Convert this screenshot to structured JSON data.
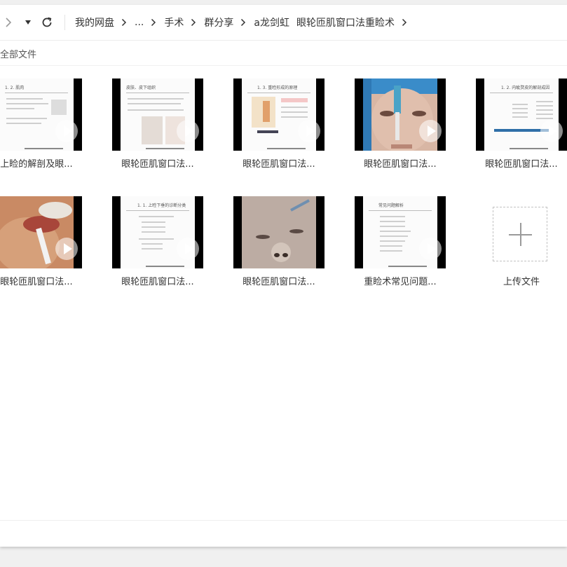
{
  "toolbar": {
    "breadcrumb": [
      "我的网盘",
      "...",
      "手术",
      "群分享",
      "a龙剑虹",
      "眼轮匝肌窗口法重睑术"
    ]
  },
  "subbar": {
    "all_files_label": "全部文件"
  },
  "files": [
    {
      "name": "上睑的解剖及眼...",
      "slide_title": "1. 2.  肌肉",
      "kind": "slide"
    },
    {
      "name": "眼轮匝肌窗口法...",
      "slide_title": "皮肤、皮下组织",
      "kind": "slide"
    },
    {
      "name": "眼轮匝肌窗口法...",
      "slide_title": "1. 3.  重睑形成的原理",
      "kind": "slide"
    },
    {
      "name": "眼轮匝肌窗口法...",
      "slide_title": "",
      "kind": "photo-face"
    },
    {
      "name": "眼轮匝肌窗口法...",
      "slide_title": "1. 2. 内眦赘皮的解剖成因",
      "kind": "slide"
    },
    {
      "name": "眼轮匝肌窗口法...",
      "slide_title": "",
      "kind": "photo-surgery"
    },
    {
      "name": "眼轮匝肌窗口法...",
      "slide_title": "1. 1. 上睑下垂的诊断分类",
      "kind": "slide"
    },
    {
      "name": "眼轮匝肌窗口法...",
      "slide_title": "",
      "kind": "photo-closeup"
    },
    {
      "name": "重睑术常见问题...",
      "slide_title": "常见问题解析",
      "kind": "slide"
    }
  ],
  "upload": {
    "label": "上传文件"
  },
  "icons": {
    "forward": "chevron-right-icon",
    "dropdown": "caret-down-icon",
    "refresh": "refresh-icon",
    "play": "play-icon",
    "upload": "plus-icon"
  }
}
